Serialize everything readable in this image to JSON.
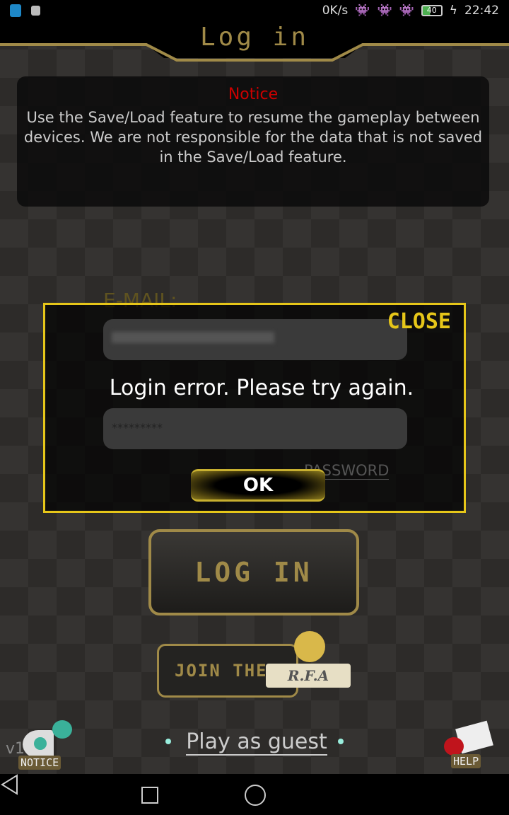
{
  "status_bar": {
    "speed": "0K/s",
    "battery": "40",
    "time": "22:42"
  },
  "header": {
    "title": "Log in"
  },
  "notice": {
    "title": "Notice",
    "body": "Use the Save/Load feature to resume the gameplay between devices. We are not responsible for the data that is not saved in the Save/Load feature."
  },
  "form": {
    "email_label": "E-MAIL:",
    "password_value": "*********",
    "forgot_label": "PASSWORD"
  },
  "dialog": {
    "close_label": "CLOSE",
    "message": "Login error. Please try again.",
    "ok_label": "OK"
  },
  "buttons": {
    "login": "LOG IN",
    "join": "JOIN THE",
    "rfa": "R.F.A",
    "guest": "Play as guest"
  },
  "footer": {
    "version": "v1 a",
    "notice": "NOTICE",
    "help": "HELP"
  },
  "colors": {
    "gold": "#a08a48",
    "dialog_border": "#e6c619",
    "notice_title": "#cc0000"
  }
}
